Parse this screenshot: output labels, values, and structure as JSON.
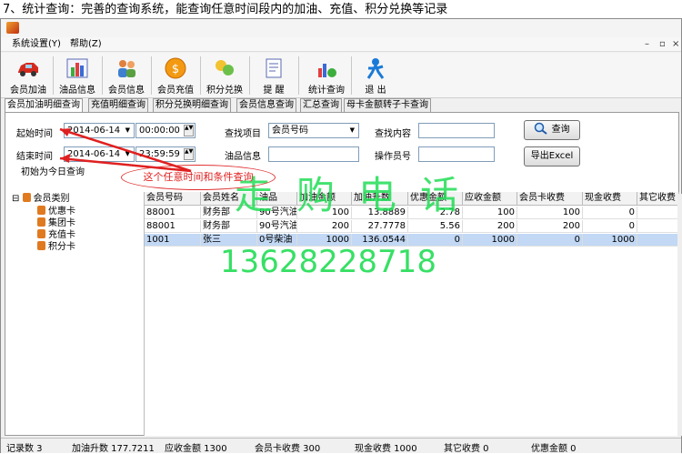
{
  "caption": "7、统计查询：完善的查询系统，能查询任意时间段内的加油、充值、积分兑换等记录",
  "menu": [
    "系统设置(Y)",
    "帮助(Z)"
  ],
  "window_controls": {
    "minimize": "–",
    "restore": "▫",
    "close": "×"
  },
  "toolbar": [
    {
      "label": "会员加油",
      "icon": "car-icon"
    },
    {
      "label": "油品信息",
      "icon": "fuel-chart-icon"
    },
    {
      "label": "会员信息",
      "icon": "users-icon"
    },
    {
      "label": "会员充值",
      "icon": "coin-icon"
    },
    {
      "label": "积分兑换",
      "icon": "exchange-icon"
    },
    {
      "label": "提  醒",
      "icon": "reminder-icon"
    },
    {
      "label": "统计查询",
      "icon": "stats-icon"
    },
    {
      "label": "退  出",
      "icon": "exit-icon"
    }
  ],
  "tabs": [
    "会员加油明细查询",
    "充值明细查询",
    "积分兑换明细查询",
    "会员信息查询",
    "汇总查询",
    "母卡金额转子卡查询"
  ],
  "filters": {
    "start_label": "起始时间",
    "start_date": "2014-06-14",
    "start_time": "00:00:00",
    "end_label": "结束时间",
    "end_date": "2014-06-14",
    "end_time": "23:59:59",
    "today_label": "初始为今日查询",
    "find_item_label": "查找项目",
    "find_item_value": "会员号码",
    "find_content_label": "查找内容",
    "find_content_value": "",
    "oil_label": "油品信息",
    "oil_value": "",
    "operator_label": "操作员号",
    "operator_value": "",
    "query_button": "查询",
    "export_button": "导出Excel"
  },
  "tree": {
    "root": "会员类别",
    "children": [
      "优惠卡",
      "集团卡",
      "充值卡",
      "积分卡"
    ]
  },
  "grid": {
    "columns": [
      "会员号码",
      "会员姓名",
      "油品",
      "加油金额",
      "加油升数",
      "优惠金额",
      "应收金额",
      "会员卡收费",
      "现金收费",
      "其它收费"
    ],
    "rows": [
      [
        "88001",
        "财务部",
        "90号汽油",
        "100",
        "13.8889",
        "2.78",
        "100",
        "100",
        "0",
        ""
      ],
      [
        "88001",
        "财务部",
        "90号汽油",
        "200",
        "27.7778",
        "5.56",
        "200",
        "200",
        "0",
        ""
      ],
      [
        "1001",
        "张三",
        "0号柴油",
        "1000",
        "136.0544",
        "0",
        "1000",
        "0",
        "1000",
        ""
      ]
    ]
  },
  "status": [
    "记录数    3",
    "加油升数   177.7211",
    "应收金额 1300",
    "会员卡收费 300",
    "现金收费 1000",
    "其它收费 0",
    "优惠金额    0"
  ],
  "watermark_cn": "走购电话",
  "watermark_phone": "13628228718",
  "annotation": "这个任意时间和条件查询",
  "colors": {
    "accent_selection": "#c2d8f4",
    "watermark": "#22dd55",
    "annotation": "#e02020"
  }
}
